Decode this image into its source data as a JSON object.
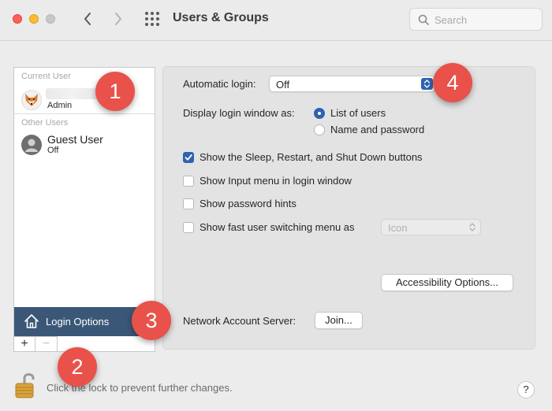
{
  "window": {
    "title": "Users & Groups"
  },
  "search": {
    "placeholder": "Search"
  },
  "sidebar": {
    "current_user_header": "Current User",
    "current_user_role": "Admin",
    "other_users_header": "Other Users",
    "guest": {
      "name": "Guest User",
      "status": "Off"
    },
    "login_options_label": "Login Options",
    "add_label": "+",
    "remove_label": "−"
  },
  "panel": {
    "automatic_login_label": "Automatic login:",
    "automatic_login_value": "Off",
    "display_login_label": "Display login window as:",
    "radio_list_label": "List of users",
    "radio_name_label": "Name and password",
    "check_sleep_label": "Show the Sleep, Restart, and Shut Down buttons",
    "check_input_label": "Show Input menu in login window",
    "check_hints_label": "Show password hints",
    "check_fast_label": "Show fast user switching menu as",
    "fast_switch_value": "Icon",
    "accessibility_button": "Accessibility Options...",
    "network_label": "Network Account Server:",
    "join_button": "Join..."
  },
  "footer": {
    "lock_text": "Click the lock to prevent further changes.",
    "help_label": "?"
  },
  "annotations": [
    "1",
    "2",
    "3",
    "4"
  ],
  "colors": {
    "accent": "#2d63b0",
    "badge": "#e8524a",
    "selection": "#3a5777"
  }
}
